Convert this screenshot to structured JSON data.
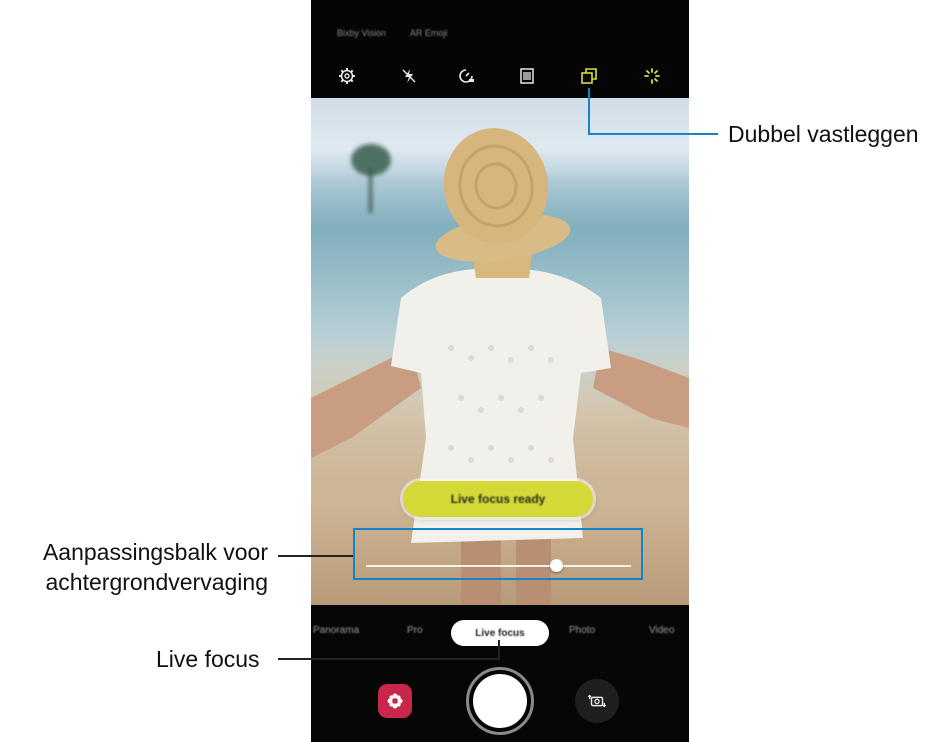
{
  "top_modes": [
    "Bixby Vision",
    "AR Emoji"
  ],
  "top_icons": [
    "settings-icon",
    "flash-off-icon",
    "timer-icon",
    "aspect-ratio-icon",
    "dual-capture-icon",
    "filter-effects-icon"
  ],
  "viewfinder": {
    "status_pill": "Live focus ready",
    "blur_level": 0.72
  },
  "modes": [
    "Panorama",
    "Pro",
    "Live focus",
    "Photo",
    "Video"
  ],
  "active_mode": "Live focus",
  "bottom_icons": [
    "bixby-icon",
    "shutter-button",
    "switch-camera-icon"
  ],
  "callouts": {
    "dual_capture": "Dubbel vastleggen",
    "blur_bar_line1": "Aanpassingsbalk voor",
    "blur_bar_line2": "achtergrondvervaging",
    "live_focus": "Live focus"
  },
  "colors": {
    "callout_line": "#1583c7",
    "active_icon": "#d6df3a",
    "bixby": "#c8264a",
    "pill": "#d3da38"
  }
}
